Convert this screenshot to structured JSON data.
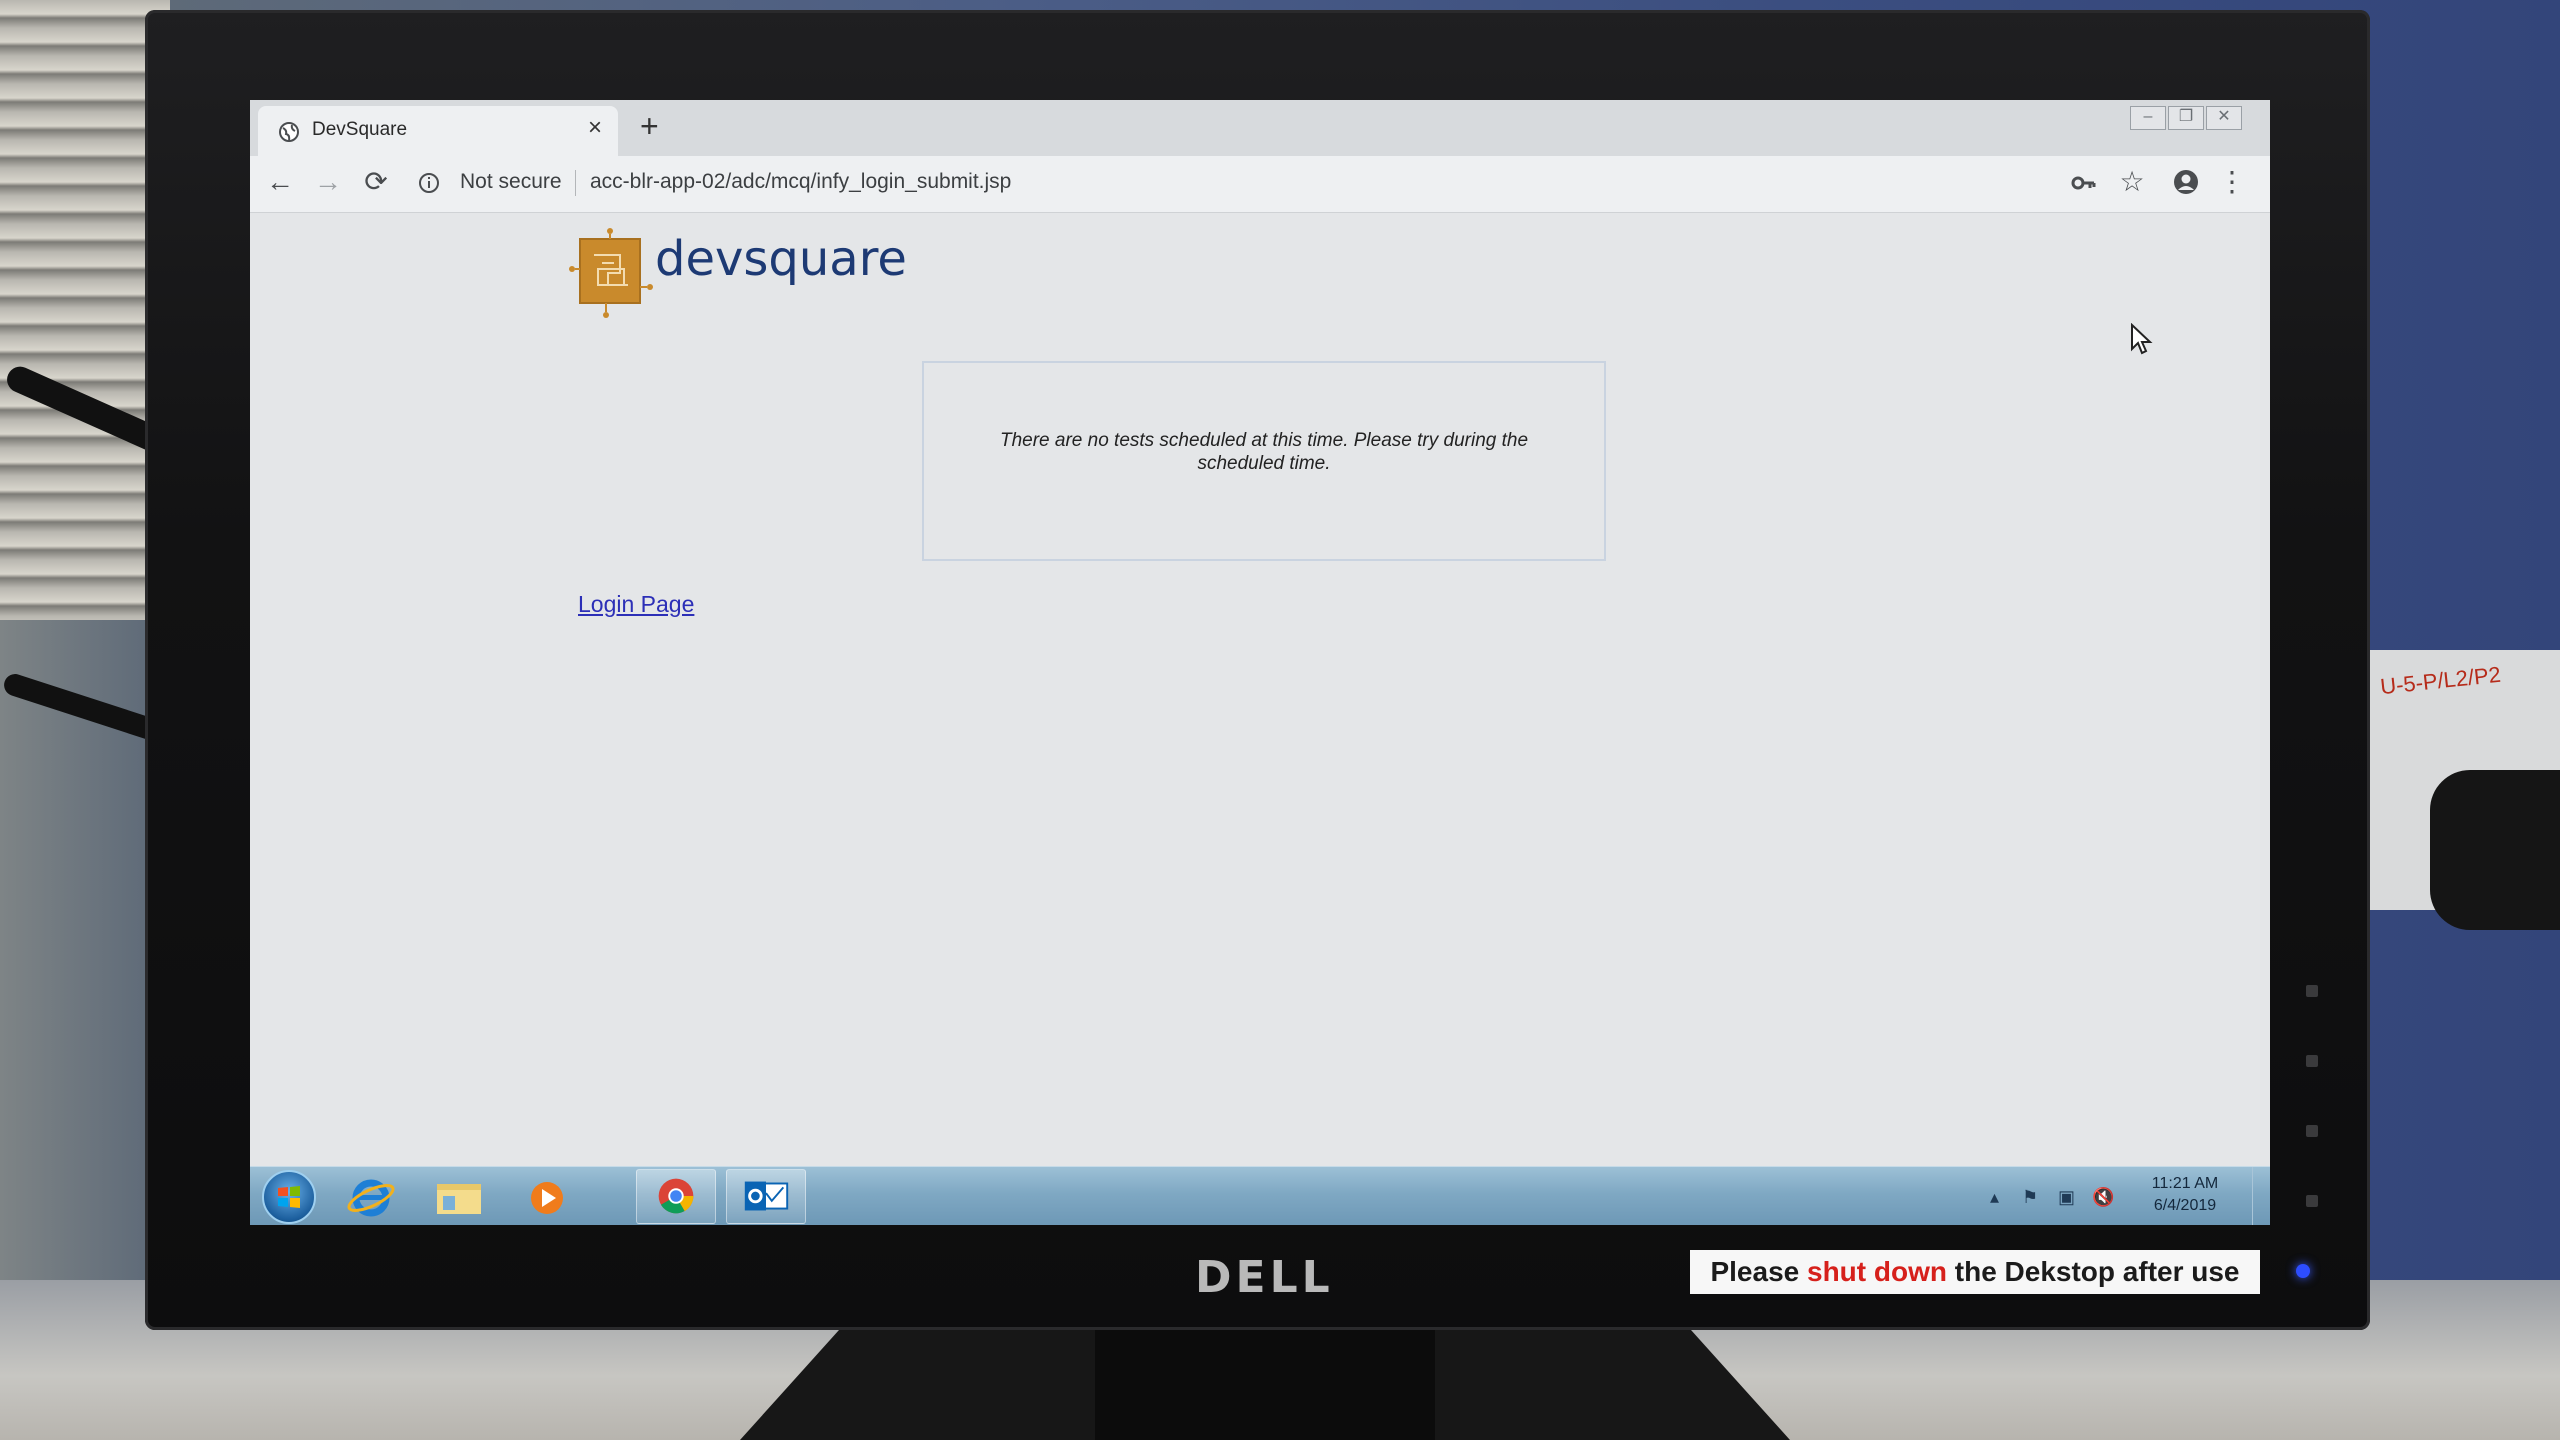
{
  "browser": {
    "tab_title": "DevSquare",
    "tab_close": "×",
    "new_tab": "+",
    "security_label": "Not secure",
    "url": "acc-blr-app-02/adc/mcq/infy_login_submit.jsp"
  },
  "page": {
    "brand_name": "devsquare",
    "message": "There are no tests scheduled at this time. Please try during the scheduled time.",
    "login_link": "Login Page"
  },
  "taskbar": {
    "apps": [
      "internet-explorer",
      "windows-explorer",
      "media-player",
      "chrome",
      "outlook"
    ],
    "clock_time": "11:21 AM",
    "clock_date": "6/4/2019"
  },
  "monitor": {
    "brand": "DELL",
    "sticker_prefix": "Please ",
    "sticker_highlight": "shut down",
    "sticker_suffix": " the Dekstop after use",
    "socket_label": "U-5-P/L2/P2"
  },
  "colors": {
    "brand_blue": "#1d3a74",
    "link_blue": "#2c2fb7",
    "sticker_red": "#d6201b"
  }
}
